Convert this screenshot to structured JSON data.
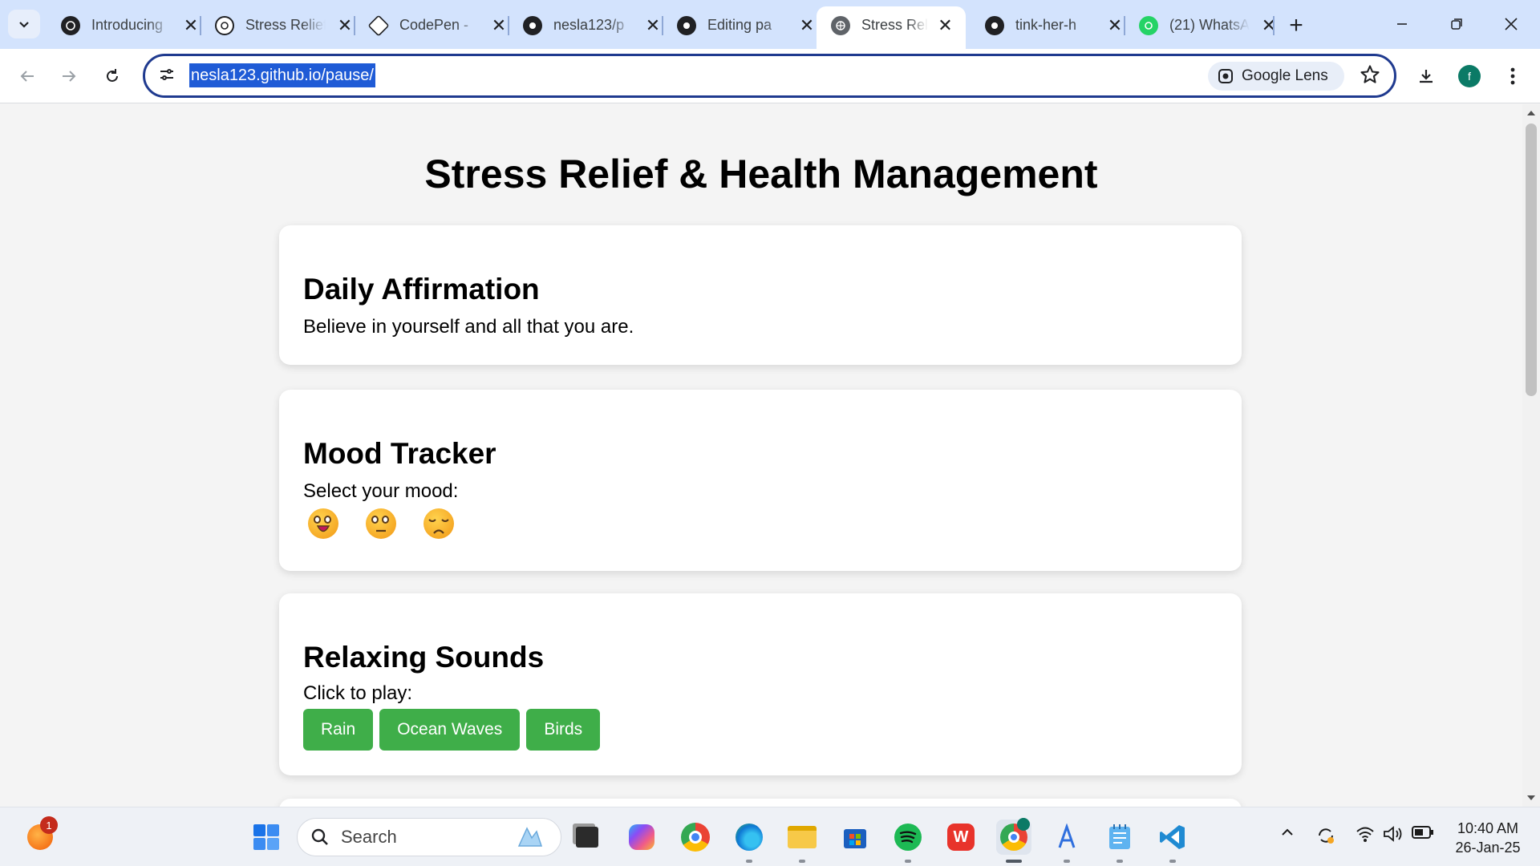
{
  "browser": {
    "tabs": [
      {
        "title": "Introducing",
        "icon": "openai-icon"
      },
      {
        "title": "Stress Relief",
        "icon": "openai-icon"
      },
      {
        "title": "CodePen -",
        "icon": "codepen-icon"
      },
      {
        "title": "nesla123/p",
        "icon": "github-icon"
      },
      {
        "title": "Editing pa",
        "icon": "github-icon"
      },
      {
        "title": "Stress Relie",
        "icon": "globe-icon",
        "active": true
      },
      {
        "title": "tink-her-h",
        "icon": "github-icon"
      },
      {
        "title": "(21) WhatsA",
        "icon": "whatsapp-icon"
      }
    ],
    "url": "nesla123.github.io/pause/",
    "lens_label": "Google Lens",
    "profile_initial": "f"
  },
  "page": {
    "title": "Stress Relief & Health Management",
    "affirmation": {
      "heading": "Daily Affirmation",
      "text": "Believe in yourself and all that you are."
    },
    "mood": {
      "heading": "Mood Tracker",
      "prompt": "Select your mood:",
      "options": [
        "happy",
        "neutral",
        "sad"
      ]
    },
    "sounds": {
      "heading": "Relaxing Sounds",
      "prompt": "Click to play:",
      "buttons": [
        "Rain",
        "Ocean Waves",
        "Birds"
      ]
    }
  },
  "taskbar": {
    "search_placeholder": "Search",
    "notification_count": "1",
    "time": "10:40 AM",
    "date": "26-Jan-25"
  },
  "colors": {
    "tabstrip": "#d3e3fd",
    "url_highlight": "#1f5bd6",
    "button_green": "#3fae49",
    "page_bg": "#f4f4f4"
  }
}
